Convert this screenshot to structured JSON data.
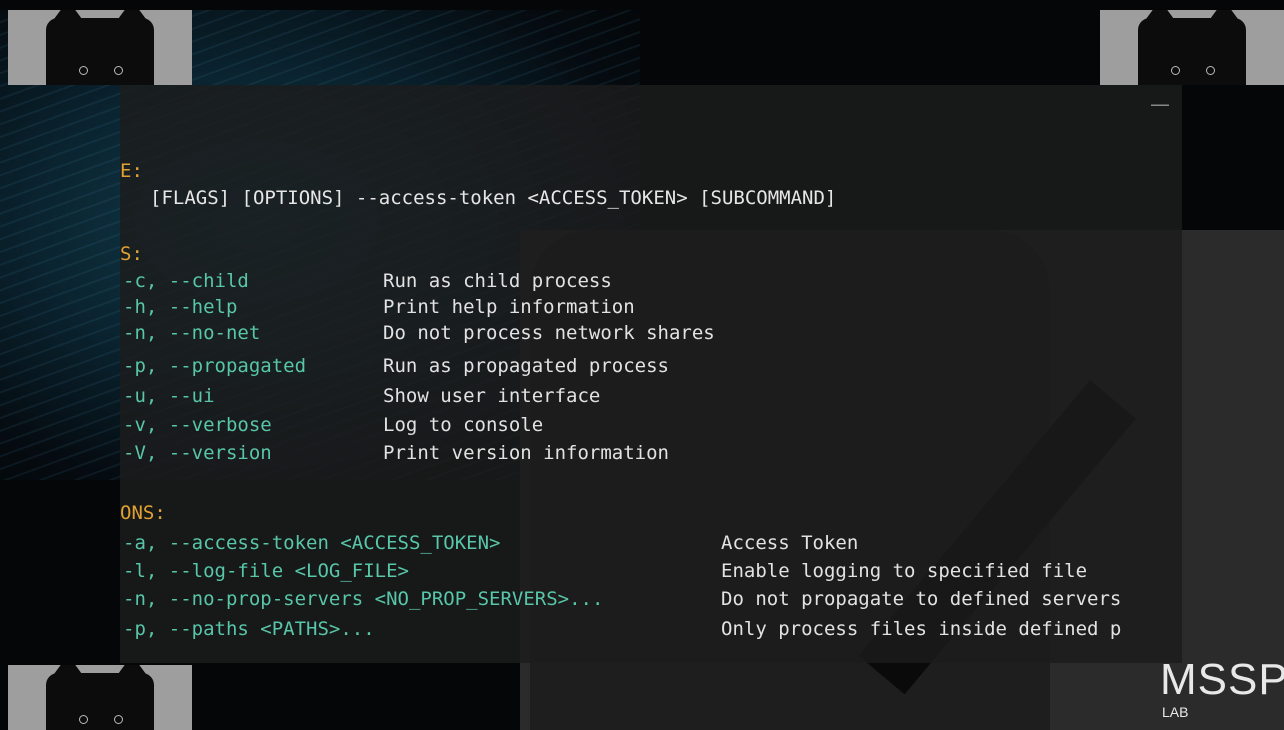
{
  "terminal": {
    "min_glyph": "—",
    "usage_header": "E:",
    "usage_line": "[FLAGS] [OPTIONS] --access-token <ACCESS_TOKEN> [SUBCOMMAND]",
    "flags_header": "S:",
    "flags": [
      {
        "flag": "-c, --child",
        "desc": "Run as child process"
      },
      {
        "flag": "-h, --help",
        "desc": "Print help information"
      },
      {
        "flag": "-n, --no-net",
        "desc": "Do not process network shares"
      },
      {
        "flag": "-p, --propagated",
        "desc": "Run as propagated process"
      },
      {
        "flag": "-u, --ui",
        "desc": "Show user interface"
      },
      {
        "flag": "-v, --verbose",
        "desc": "Log to console"
      },
      {
        "flag": "-V, --version",
        "desc": "Print version information"
      }
    ],
    "options_header": "ONS:",
    "options": [
      {
        "flag": "-a, --access-token <ACCESS_TOKEN>",
        "desc": "Access Token"
      },
      {
        "flag": "-l, --log-file <LOG_FILE>",
        "desc": "Enable logging to specified file"
      },
      {
        "flag": "-n, --no-prop-servers <NO_PROP_SERVERS>...",
        "desc": "Do not propagate to defined servers"
      },
      {
        "flag": "-p, --paths <PATHS>...",
        "desc": "Only process files inside defined p"
      }
    ]
  },
  "logo": {
    "main": "MSSP",
    "sub": "LAB"
  },
  "colors": {
    "header": "#e2a232",
    "flag": "#58c6a8",
    "text": "#e2e2e2"
  }
}
